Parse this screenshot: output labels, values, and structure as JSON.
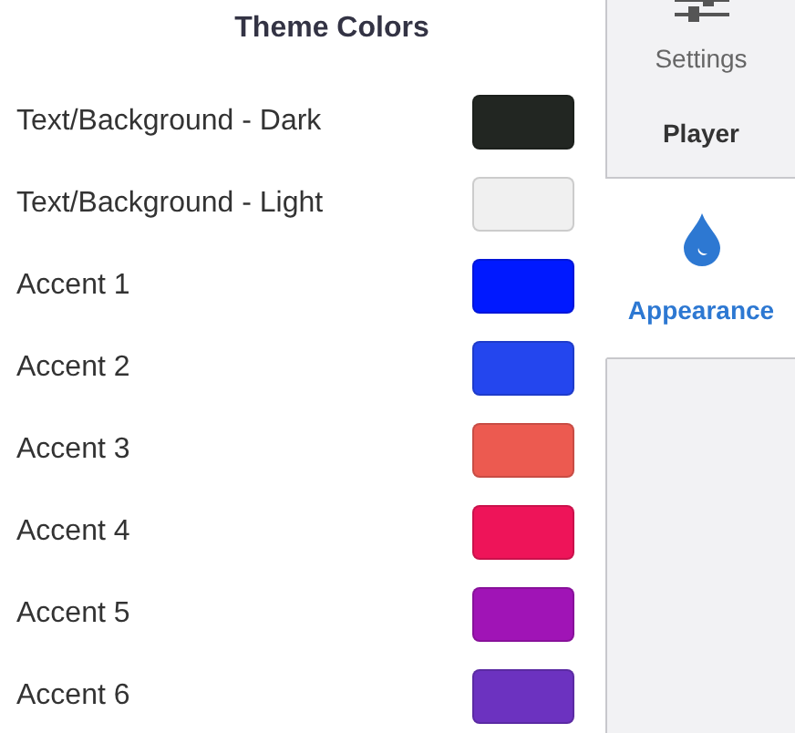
{
  "panel": {
    "title": "Theme Colors",
    "colors": [
      {
        "label": "Text/Background - Dark",
        "color": "#222622"
      },
      {
        "label": "Text/Background - Light",
        "color": "#f0f0f0"
      },
      {
        "label": "Accent 1",
        "color": "#0019ff"
      },
      {
        "label": "Accent 2",
        "color": "#2446ee"
      },
      {
        "label": "Accent 3",
        "color": "#ec5a50"
      },
      {
        "label": "Accent 4",
        "color": "#ee1459"
      },
      {
        "label": "Accent 5",
        "color": "#a014b6"
      },
      {
        "label": "Accent 6",
        "color": "#6c32c0"
      }
    ]
  },
  "tabs": [
    {
      "kind": "sliders",
      "caption": "Settings",
      "label": "Player",
      "selected": false
    },
    {
      "kind": "drop",
      "label": "Appearance",
      "selected": true
    }
  ]
}
